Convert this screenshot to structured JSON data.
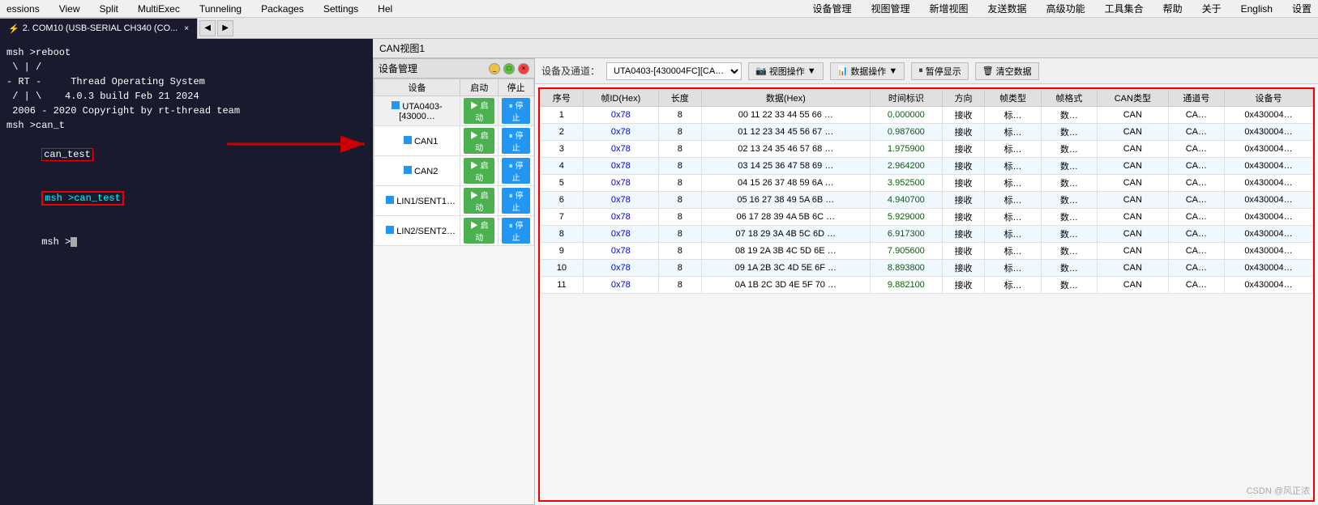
{
  "menubar": {
    "items": [
      "essions",
      "View",
      "Split",
      "MultiExec",
      "Tunneling",
      "Packages",
      "Settings",
      "Hel"
    ]
  },
  "top_toolbar": {
    "items": [
      "设备管理",
      "视图管理",
      "新增视图",
      "友送数据",
      "高级功能",
      "工具集合",
      "帮助",
      "关于",
      "English",
      "设置"
    ]
  },
  "tab": {
    "serial_tab": {
      "label": "2. COM10 (USB-SERIAL CH340 (CO...",
      "icon": "⚡"
    },
    "can_view_tab": "CAN视图1"
  },
  "terminal": {
    "lines": [
      "msh >reboot",
      "",
      " \\ | /",
      "- RT -     Thread Operating System",
      " / | \\    4.0.3 build Feb 21 2024",
      " 2006 - 2020 Copyright by rt-thread team",
      "msh >can_t",
      "can_test",
      "msh >can_test",
      "msh >"
    ]
  },
  "device_mgmt": {
    "title": "设备管理",
    "columns": [
      "设备",
      "启动",
      "停止"
    ],
    "devices": [
      {
        "name": "UTA0403-[43000…",
        "type": "parent",
        "start": "启动",
        "stop": "停止"
      },
      {
        "name": "CAN1",
        "type": "child",
        "start": "启动",
        "stop": "停止"
      },
      {
        "name": "CAN2",
        "type": "child",
        "start": "启动",
        "stop": "停止"
      },
      {
        "name": "LIN1/SENT1…",
        "type": "child",
        "start": "启动",
        "stop": "停止"
      },
      {
        "name": "LIN2/SENT2…",
        "type": "child",
        "start": "启动",
        "stop": "停止"
      }
    ]
  },
  "can_view": {
    "title": "CAN视图1",
    "toolbar": {
      "device_label": "设备及通道：",
      "device_select": "UTA0403-[430004FC][CA…",
      "view_ops": "视图操作",
      "data_ops": "数据操作",
      "pause": "暂停显示",
      "clear": "清空数据"
    },
    "table_headers": [
      "序号",
      "帧ID(Hex)",
      "长度",
      "数据(Hex)",
      "时间标识",
      "方向",
      "帧类型",
      "帧格式",
      "CAN类型",
      "通道号",
      "设备号"
    ],
    "rows": [
      {
        "seq": "1",
        "id": "0x78",
        "len": "8",
        "data": "00 11 22 33 44 55 66 …",
        "time": "0.000000",
        "dir": "接收",
        "frame": "标…",
        "fmt": "数…",
        "can": "CAN",
        "ch": "CA…",
        "dev": "0x430004…"
      },
      {
        "seq": "2",
        "id": "0x78",
        "len": "8",
        "data": "01 12 23 34 45 56 67 …",
        "time": "0.987600",
        "dir": "接收",
        "frame": "标…",
        "fmt": "数…",
        "can": "CAN",
        "ch": "CA…",
        "dev": "0x430004…"
      },
      {
        "seq": "3",
        "id": "0x78",
        "len": "8",
        "data": "02 13 24 35 46 57 68 …",
        "time": "1.975900",
        "dir": "接收",
        "frame": "标…",
        "fmt": "数…",
        "can": "CAN",
        "ch": "CA…",
        "dev": "0x430004…"
      },
      {
        "seq": "4",
        "id": "0x78",
        "len": "8",
        "data": "03 14 25 36 47 58 69 …",
        "time": "2.964200",
        "dir": "接收",
        "frame": "标…",
        "fmt": "数…",
        "can": "CAN",
        "ch": "CA…",
        "dev": "0x430004…"
      },
      {
        "seq": "5",
        "id": "0x78",
        "len": "8",
        "data": "04 15 26 37 48 59 6A …",
        "time": "3.952500",
        "dir": "接收",
        "frame": "标…",
        "fmt": "数…",
        "can": "CAN",
        "ch": "CA…",
        "dev": "0x430004…"
      },
      {
        "seq": "6",
        "id": "0x78",
        "len": "8",
        "data": "05 16 27 38 49 5A 6B …",
        "time": "4.940700",
        "dir": "接收",
        "frame": "标…",
        "fmt": "数…",
        "can": "CAN",
        "ch": "CA…",
        "dev": "0x430004…"
      },
      {
        "seq": "7",
        "id": "0x78",
        "len": "8",
        "data": "06 17 28 39 4A 5B 6C …",
        "time": "5.929000",
        "dir": "接收",
        "frame": "标…",
        "fmt": "数…",
        "can": "CAN",
        "ch": "CA…",
        "dev": "0x430004…"
      },
      {
        "seq": "8",
        "id": "0x78",
        "len": "8",
        "data": "07 18 29 3A 4B 5C 6D …",
        "time": "6.917300",
        "dir": "接收",
        "frame": "标…",
        "fmt": "数…",
        "can": "CAN",
        "ch": "CA…",
        "dev": "0x430004…"
      },
      {
        "seq": "9",
        "id": "0x78",
        "len": "8",
        "data": "08 19 2A 3B 4C 5D 6E …",
        "time": "7.905600",
        "dir": "接收",
        "frame": "标…",
        "fmt": "数…",
        "can": "CAN",
        "ch": "CA…",
        "dev": "0x430004…"
      },
      {
        "seq": "10",
        "id": "0x78",
        "len": "8",
        "data": "09 1A 2B 3C 4D 5E 6F …",
        "time": "8.893800",
        "dir": "接收",
        "frame": "标…",
        "fmt": "数…",
        "can": "CAN",
        "ch": "CA…",
        "dev": "0x430004…"
      },
      {
        "seq": "11",
        "id": "0x78",
        "len": "8",
        "data": "0A 1B 2C 3D 4E 5F 70 …",
        "time": "9.882100",
        "dir": "接收",
        "frame": "标…",
        "fmt": "数…",
        "can": "CAN",
        "ch": "CA…",
        "dev": "0x430004…"
      }
    ]
  },
  "watermark": "CSDN @风正浓"
}
